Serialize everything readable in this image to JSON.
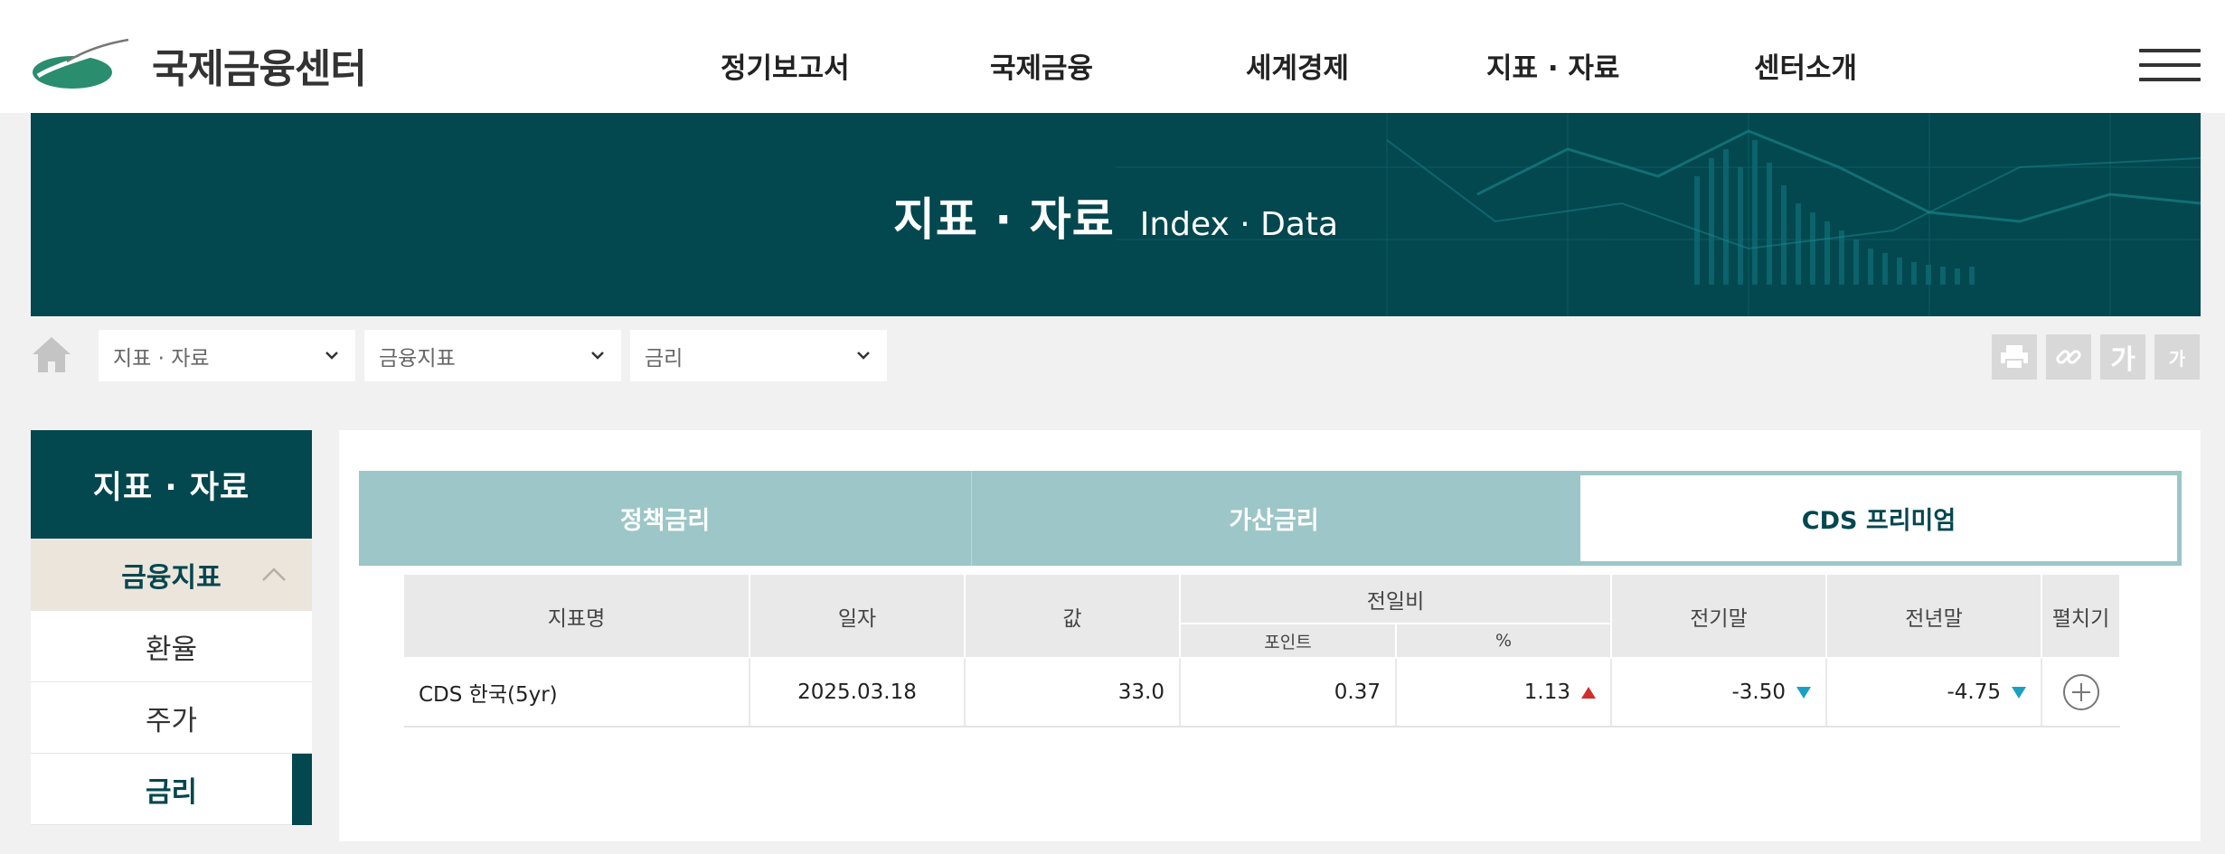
{
  "header": {
    "logo_text": "국제금융센터",
    "nav": [
      "정기보고서",
      "국제금융",
      "세계경제",
      "지표 · 자료",
      "센터소개"
    ]
  },
  "banner": {
    "title_ko": "지표 · 자료",
    "title_en": "Index · Data"
  },
  "breadcrumb": {
    "level1": "지표 · 자료",
    "level2": "금융지표",
    "level3": "금리"
  },
  "toolbar": {
    "font_large": "가",
    "font_small": "가"
  },
  "sidebar": {
    "title": "지표 · 자료",
    "category": "금융지표",
    "items": [
      "환율",
      "주가",
      "금리"
    ]
  },
  "tabs": [
    "정책금리",
    "가산금리",
    "CDS 프리미엄"
  ],
  "table": {
    "headers": {
      "name": "지표명",
      "date": "일자",
      "value": "값",
      "change": "전일비",
      "change_point": "포인트",
      "change_pct": "%",
      "prev_period": "전기말",
      "prev_year": "전년말",
      "expand": "펼치기"
    },
    "rows": [
      {
        "name": "CDS 한국(5yr)",
        "date": "2025.03.18",
        "value": "33.0",
        "change_point": "0.37",
        "change_pct": "1.13",
        "prev_period": "-3.50",
        "prev_year": "-4.75"
      }
    ]
  },
  "colors": {
    "brand": "#03474f",
    "tab_bg": "#9cc6c7",
    "up": "#d22d2d",
    "down": "#1ba0c5"
  }
}
